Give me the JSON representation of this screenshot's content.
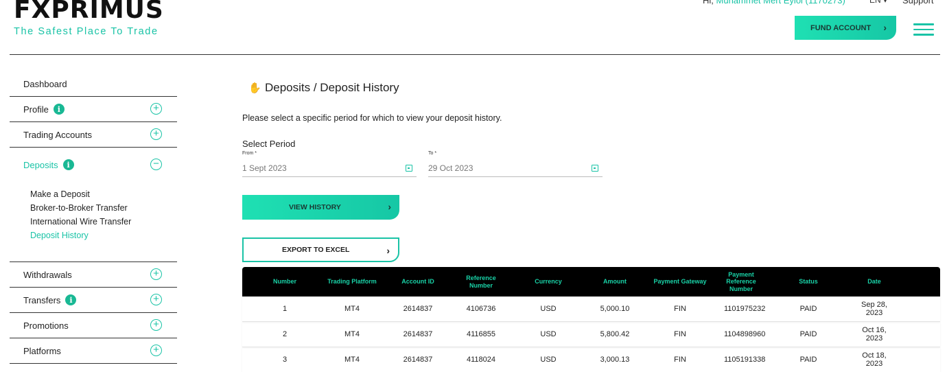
{
  "brand": {
    "logo": "FXPRIMUS",
    "tagline": "The Safest Place To Trade"
  },
  "topbar": {
    "greeting": "Hi,",
    "user": "Muhammet Mert Eylol (1170273)",
    "language": "EN",
    "support": "Support",
    "fund_account": "FUND ACCOUNT"
  },
  "sidebar": {
    "items": [
      {
        "label": "Dashboard"
      },
      {
        "label": "Profile",
        "badge": "i"
      },
      {
        "label": "Trading Accounts"
      },
      {
        "label": "Deposits",
        "badge": "i"
      },
      {
        "label": "Withdrawals"
      },
      {
        "label": "Transfers",
        "badge": "i"
      },
      {
        "label": "Promotions"
      },
      {
        "label": "Platforms"
      }
    ],
    "deposit_submenu": [
      "Make a Deposit",
      "Broker-to-Broker Transfer",
      "International Wire Transfer",
      "Deposit History"
    ]
  },
  "main": {
    "title": "Deposits / Deposit History",
    "intro": "Please select a specific period for which to view your deposit history.",
    "select_period": "Select Period",
    "from_label": "From *",
    "from_value": "1 Sept 2023",
    "to_label": "To *",
    "to_value": "29 Oct 2023",
    "view_history": "VIEW HISTORY",
    "export": "EXPORT TO EXCEL"
  },
  "table": {
    "headers": [
      "Number",
      "Trading Platform",
      "Account ID",
      "Reference Number",
      "Currency",
      "Amount",
      "Payment Gateway",
      "Payment Reference Number",
      "Status",
      "Date"
    ],
    "rows": [
      [
        "1",
        "MT4",
        "2614837",
        "4106736",
        "USD",
        "5,000.10",
        "FIN",
        "1101975232",
        "PAID",
        "Sep 28, 2023"
      ],
      [
        "2",
        "MT4",
        "2614837",
        "4116855",
        "USD",
        "5,800.42",
        "FIN",
        "1104898960",
        "PAID",
        "Oct 16, 2023"
      ],
      [
        "3",
        "MT4",
        "2614837",
        "4118024",
        "USD",
        "3,000.13",
        "FIN",
        "1105191338",
        "PAID",
        "Oct 18, 2023"
      ]
    ]
  },
  "colors": {
    "accent": "#19c3a6",
    "table_header_bg": "#000000",
    "table_header_text": "#19d3a8"
  }
}
